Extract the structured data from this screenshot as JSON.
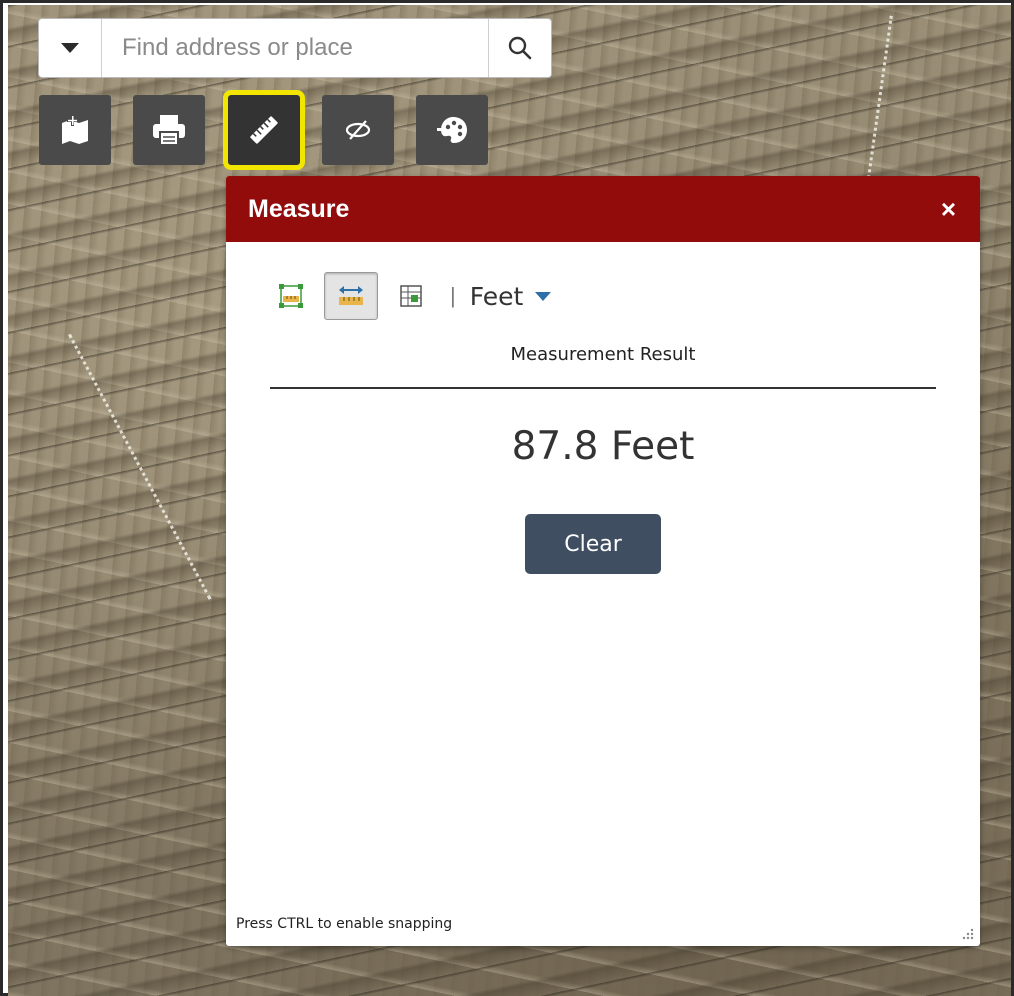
{
  "search": {
    "placeholder": "Find address or place",
    "value": ""
  },
  "toolbar": [
    {
      "name": "add-data",
      "icon": "map-plus-icon"
    },
    {
      "name": "print",
      "icon": "printer-icon"
    },
    {
      "name": "measure",
      "icon": "ruler-icon",
      "active": true
    },
    {
      "name": "visibility",
      "icon": "eye-slash-icon"
    },
    {
      "name": "basemap",
      "icon": "palette-icon"
    }
  ],
  "colors": {
    "header": "#920c0c",
    "highlight": "#f2e600",
    "clear_button": "#3f4f61",
    "tool_bg": "#4a4a4a"
  },
  "measure": {
    "title": "Measure",
    "close": "×",
    "tools": [
      {
        "name": "area",
        "icon": "area-ruler-icon"
      },
      {
        "name": "distance",
        "icon": "distance-ruler-icon",
        "selected": true
      },
      {
        "name": "location",
        "icon": "location-grid-icon"
      }
    ],
    "separator": "|",
    "unit": "Feet",
    "result_label": "Measurement Result",
    "result_value": "87.8 Feet",
    "clear_label": "Clear",
    "hint": "Press CTRL to enable snapping"
  }
}
